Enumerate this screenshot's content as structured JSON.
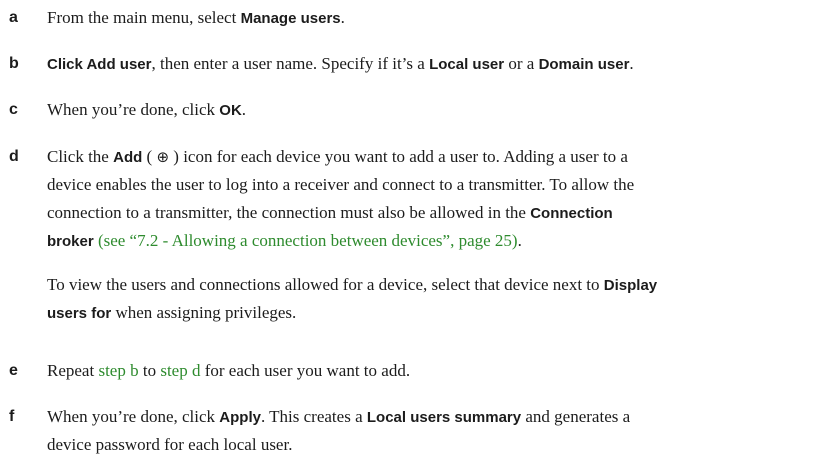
{
  "steps": {
    "a": {
      "letter": "a",
      "t1": "From the main menu, select ",
      "ui1": "Manage users",
      "t2": "."
    },
    "b": {
      "letter": "b",
      "ui1": "Click Add user",
      "t1": ", then enter a user name. Specify if it’s a ",
      "ui2": "Local user",
      "t2": " or a ",
      "ui3": "Domain user",
      "t3": "."
    },
    "c": {
      "letter": "c",
      "t1": "When you’re done, click ",
      "ui1": "OK",
      "t2": "."
    },
    "d": {
      "letter": "d",
      "line1_t1": "Click the ",
      "line1_ui1": "Add",
      "line1_t2": " ( ",
      "line1_icon": "⊕",
      "line1_t3": " ) icon for each device you want to add a user to. Adding a user to a",
      "line2": "device enables the user to log into a receiver and connect to a transmitter. To allow the",
      "line3_t1": "connection to a transmitter, the connection must also be allowed in the ",
      "line3_ui1": "Connection",
      "line4_ui1": "broker",
      "line4_t1": " ",
      "line4_link": "(see “7.2 - Allowing a connection between devices”, page 25)",
      "line4_t2": ".",
      "note_line1_t1": "To view the users and connections allowed for a device, select that device next to ",
      "note_line1_ui1": "Display",
      "note_line2_ui1": "users for",
      "note_line2_t1": " when assigning privileges."
    },
    "e": {
      "letter": "e",
      "t1": "Repeat ",
      "link1": "step b",
      "t2": " to ",
      "link2": "step d",
      "t3": " for each user you want to add."
    },
    "f": {
      "letter": "f",
      "line1_t1": "When you’re done, click ",
      "line1_ui1": "Apply",
      "line1_t2": ". This creates a ",
      "line1_ui2": "Local users summary",
      "line1_t3": " and generates a",
      "line2": "device password for each local user."
    }
  },
  "colors": {
    "text": "#1c1c1c",
    "link": "#2e8b2e"
  },
  "icons": {
    "add": "circled-plus-icon"
  }
}
